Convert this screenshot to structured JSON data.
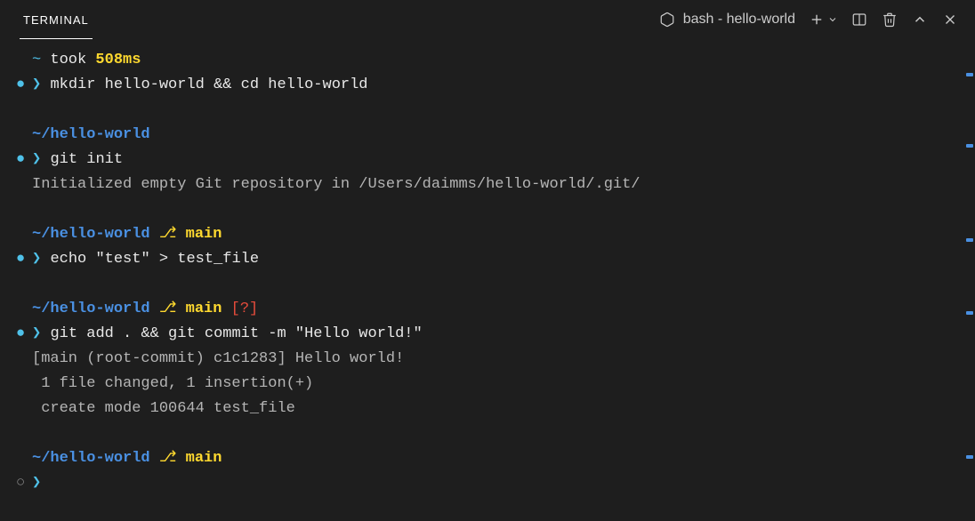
{
  "tab": {
    "label": "TERMINAL"
  },
  "shell": {
    "label": "bash - hello-world"
  },
  "blocks": [
    {
      "status": "filled",
      "path": "~",
      "took": "took",
      "time": "508ms",
      "branch": null,
      "flags": null,
      "command": "mkdir hello-world && cd hello-world",
      "output": []
    },
    {
      "status": "filled",
      "path": "~/hello-world",
      "took": null,
      "time": null,
      "branch": null,
      "flags": null,
      "command": "git init",
      "output": [
        "Initialized empty Git repository in /Users/daimms/hello-world/.git/"
      ]
    },
    {
      "status": "filled",
      "path": "~/hello-world",
      "took": null,
      "time": null,
      "branch": "main",
      "flags": null,
      "command": "echo \"test\" > test_file",
      "output": []
    },
    {
      "status": "filled",
      "path": "~/hello-world",
      "took": null,
      "time": null,
      "branch": "main",
      "flags": "[?]",
      "command": "git add . && git commit -m \"Hello world!\"",
      "output": [
        "[main (root-commit) c1c1283] Hello world!",
        " 1 file changed, 1 insertion(+)",
        " create mode 100644 test_file"
      ]
    },
    {
      "status": "empty",
      "path": "~/hello-world",
      "took": null,
      "time": null,
      "branch": "main",
      "flags": null,
      "command": "",
      "output": []
    }
  ],
  "scroll_marks": [
    82,
    162,
    268,
    350,
    512
  ]
}
